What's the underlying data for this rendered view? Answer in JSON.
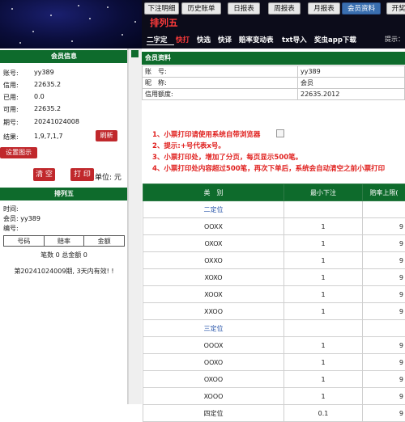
{
  "top_tabs": [
    {
      "label": "下注明细",
      "active": false
    },
    {
      "label": "历史账单",
      "active": false
    },
    {
      "label": "日报表",
      "active": false
    },
    {
      "label": "周报表",
      "active": false
    },
    {
      "label": "月报表",
      "active": false
    },
    {
      "label": "会员资料",
      "active": true
    },
    {
      "label": "开奖",
      "active": false
    }
  ],
  "section_title": "排列五",
  "sub_nav": [
    {
      "label": "二字定",
      "active": false
    },
    {
      "label": "快打",
      "active": true
    },
    {
      "label": "快选",
      "active": false
    },
    {
      "label": "快译",
      "active": false
    },
    {
      "label": "赔率变动表",
      "active": false
    },
    {
      "label": "txt导入",
      "active": false
    },
    {
      "label": "奖虫app下载",
      "active": false
    }
  ],
  "sub_nav_hint": "提示：",
  "member_info": {
    "header": "会员信息",
    "rows": [
      {
        "label": "账号:",
        "value": "yy389"
      },
      {
        "label": "信用:",
        "value": "22635.2"
      },
      {
        "label": "已用:",
        "value": "0.0"
      },
      {
        "label": "可用:",
        "value": "22635.2"
      },
      {
        "label": "期号:",
        "value": "20241024008"
      },
      {
        "label": "结果:",
        "value": "1,9,7,1,7"
      }
    ],
    "refresh_label": "刷新",
    "settings_label": "设置图示",
    "clear_label": "清 空",
    "print_label": "打 印",
    "unit_label": "单位: 元"
  },
  "ticket": {
    "header": "排列五",
    "time_label": "时间:",
    "member_label": "会员: yy389",
    "number_label": "编号:",
    "columns": [
      "号码",
      "赔率",
      "金额"
    ],
    "summary": "笔数 0 总金额 0",
    "note": "第20241024009期, 3天内有效! !"
  },
  "account": {
    "header": "会员资料",
    "rows": [
      {
        "label": "账　号:",
        "value": "yy389"
      },
      {
        "label": "昵　称:",
        "value": "会员"
      },
      {
        "label": "信用额度:",
        "value": "22635.2012"
      }
    ]
  },
  "notes": [
    "1、小票打印请使用系统自带浏览器",
    "2、提示:+号代表x号。",
    "3、小票打印处，增加了分页，每页显示500笔。",
    "4、小票打印处内容超过500笔，再次下单后，系统会自动清空之前小票打印"
  ],
  "limits_table": {
    "columns": [
      "类　别",
      "最小下注",
      "赔率上限("
    ],
    "rows": [
      {
        "type": "group",
        "label": "二定位"
      },
      {
        "type": "item",
        "label": "OOXX",
        "min": "1",
        "max": "9"
      },
      {
        "type": "item",
        "label": "OXOX",
        "min": "1",
        "max": "9"
      },
      {
        "type": "item",
        "label": "OXXO",
        "min": "1",
        "max": "9"
      },
      {
        "type": "item",
        "label": "XOXO",
        "min": "1",
        "max": "9"
      },
      {
        "type": "item",
        "label": "XOOX",
        "min": "1",
        "max": "9"
      },
      {
        "type": "item",
        "label": "XXOO",
        "min": "1",
        "max": "9"
      },
      {
        "type": "group",
        "label": "三定位"
      },
      {
        "type": "item",
        "label": "OOOX",
        "min": "1",
        "max": "9"
      },
      {
        "type": "item",
        "label": "OOXO",
        "min": "1",
        "max": "9"
      },
      {
        "type": "item",
        "label": "OXOO",
        "min": "1",
        "max": "9"
      },
      {
        "type": "item",
        "label": "XOOO",
        "min": "1",
        "max": "9"
      },
      {
        "type": "item",
        "label": "四定位",
        "min": "0.1",
        "max": "9"
      }
    ]
  },
  "colors": {
    "header_green": "#0e6b2c",
    "button_red": "#c0282c",
    "note_red": "#e0201e",
    "category_blue": "#2653a8"
  }
}
